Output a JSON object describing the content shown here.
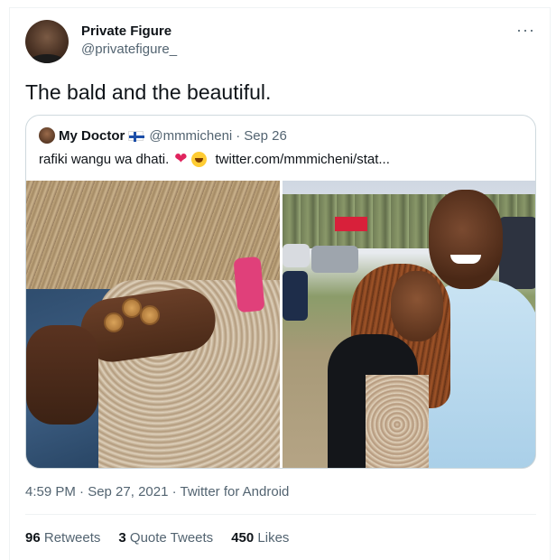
{
  "tweet": {
    "author_name": "Private Figure",
    "author_handle": "@privatefigure_",
    "text": "The bald and the beautiful.",
    "timestamp": "4:59 PM · Sep 27, 2021 · Twitter for Android",
    "more_icon": "more-horizontal-icon"
  },
  "quote": {
    "author_name": "My Doctor",
    "flag_icon": "finland-flag-icon",
    "handle": "@mmmicheni",
    "separator": "·",
    "date": "Sep 26",
    "text": "rafiki wangu wa dhati.",
    "emoji_heart": "❤",
    "emoji_smile": "smiling-face-icon",
    "link": "twitter.com/mmmicheni/stat..."
  },
  "stats": {
    "retweets_count": "96",
    "retweets_label": "Retweets",
    "quote_count": "3",
    "quote_label": "Quote Tweets",
    "likes_count": "450",
    "likes_label": "Likes"
  },
  "colors": {
    "text_primary": "#0f1419",
    "text_secondary": "#536471",
    "border": "#cfd9de",
    "heart": "#e0245e"
  }
}
